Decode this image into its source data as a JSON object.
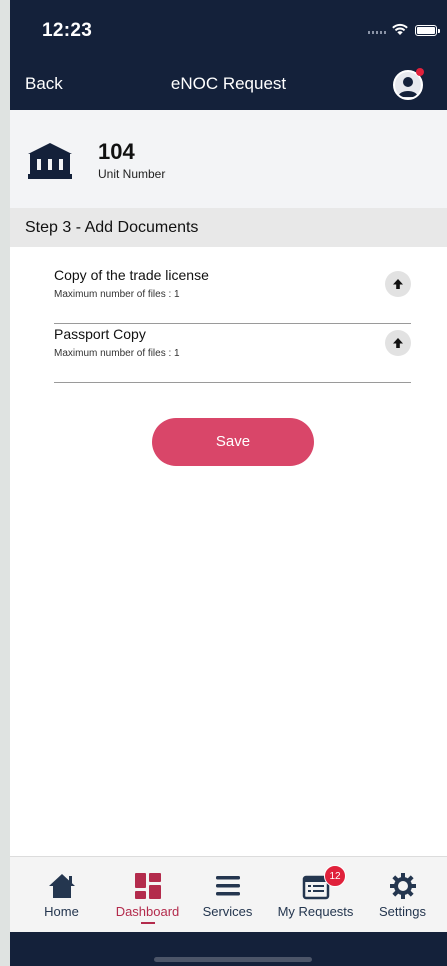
{
  "status_bar": {
    "time": "12:23"
  },
  "nav": {
    "back_label": "Back",
    "title": "eNOC Request",
    "avatar_icon": "user-avatar-icon",
    "notification_color": "#e0213b"
  },
  "unit": {
    "number": "104",
    "label": "Unit Number",
    "icon": "building-icon"
  },
  "step": {
    "label": "Step 3 - Add Documents"
  },
  "documents": [
    {
      "title": "Copy of the trade license",
      "subtitle": "Maximum number of files : 1",
      "action_icon": "upload-arrow-icon"
    },
    {
      "title": "Passport Copy",
      "subtitle": "Maximum number of files : 1",
      "action_icon": "upload-arrow-icon"
    }
  ],
  "save_button": {
    "label": "Save",
    "color": "#d94669"
  },
  "tabs": [
    {
      "label": "Home",
      "icon": "home-icon",
      "active": false
    },
    {
      "label": "Dashboard",
      "icon": "dashboard-icon",
      "active": true
    },
    {
      "label": "Services",
      "icon": "menu-icon",
      "active": false
    },
    {
      "label": "My Requests",
      "icon": "requests-icon",
      "active": false,
      "badge": "12"
    },
    {
      "label": "Settings",
      "icon": "gear-icon",
      "active": false
    }
  ],
  "colors": {
    "nav_bg": "#14213a",
    "accent": "#b32b4c",
    "tab_icon": "#24364f"
  }
}
